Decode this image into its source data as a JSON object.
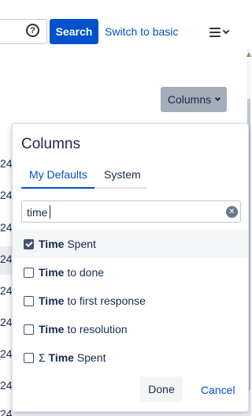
{
  "header": {
    "help_glyph": "?",
    "search_label": "Search",
    "switch_label": "Switch to basic",
    "menu_icon": "hamburger-menu-icon"
  },
  "toolbar": {
    "columns_label": "Columns"
  },
  "background_rows": [
    "24",
    "24",
    "24",
    "24",
    "24",
    "24",
    "24",
    "24",
    "24"
  ],
  "columns_panel": {
    "title": "Columns",
    "tabs": [
      {
        "label": "My Defaults",
        "active": true
      },
      {
        "label": "System",
        "active": false
      }
    ],
    "filter_value": "time",
    "options": [
      {
        "prefix": "",
        "bold": "Time",
        "rest": " Spent",
        "checked": true
      },
      {
        "prefix": "",
        "bold": "Time",
        "rest": " to done",
        "checked": false
      },
      {
        "prefix": "",
        "bold": "Time",
        "rest": " to first response",
        "checked": false
      },
      {
        "prefix": "",
        "bold": "Time",
        "rest": " to resolution",
        "checked": false
      },
      {
        "prefix": "Σ ",
        "bold": "Time",
        "rest": " Spent",
        "checked": false
      }
    ],
    "done_label": "Done",
    "cancel_label": "Cancel"
  },
  "colors": {
    "primary": "#0052cc",
    "text": "#172b4d",
    "columns_button_bg": "#a5adba"
  }
}
